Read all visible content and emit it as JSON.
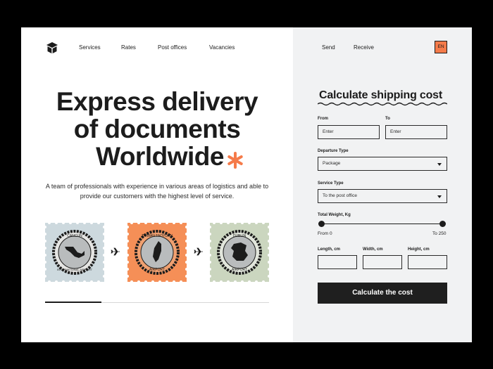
{
  "brand": {
    "icon": "package-box-icon"
  },
  "nav": {
    "left": [
      "Services",
      "Rates",
      "Post offices",
      "Vacancies"
    ],
    "right": [
      "Send",
      "Receive"
    ],
    "language": "EN"
  },
  "hero": {
    "line1": "Express delivery",
    "line2": "of documents",
    "line3": "Worldwide",
    "description": "A team of professionals with experience in various areas of logistics and able to provide our customers with the highest level of service."
  },
  "stamps": [
    {
      "top_text": "CANCUN",
      "bottom_text": "INTERNATIONAL AIRPORT",
      "color": "#cdd9de"
    },
    {
      "top_text": "TAIWAN TAOYUAN",
      "bottom_text": "AIRPORT",
      "color": "#f58f57"
    },
    {
      "top_text": "DUBLIN",
      "bottom_text": "AIRPORT",
      "color": "#cbd6bf"
    }
  ],
  "progress": {
    "fraction": 0.25
  },
  "calculator": {
    "title": "Calculate shipping cost",
    "from_label": "From",
    "from_placeholder": "Enter",
    "to_label": "To",
    "to_placeholder": "Enter",
    "departure_label": "Departure Type",
    "departure_value": "Package",
    "service_label": "Service Type",
    "service_value": "To the post office",
    "weight_label": "Total Weight, Kg",
    "weight_min": "From 0",
    "weight_max": "To 250",
    "length_label": "Length, cm",
    "width_label": "Width, cm",
    "height_label": "Height, cm",
    "cta": "Calculate the cost"
  },
  "colors": {
    "accent": "#f57b4a",
    "panel": "#f1f2f3",
    "dark": "#1f1f1f"
  }
}
